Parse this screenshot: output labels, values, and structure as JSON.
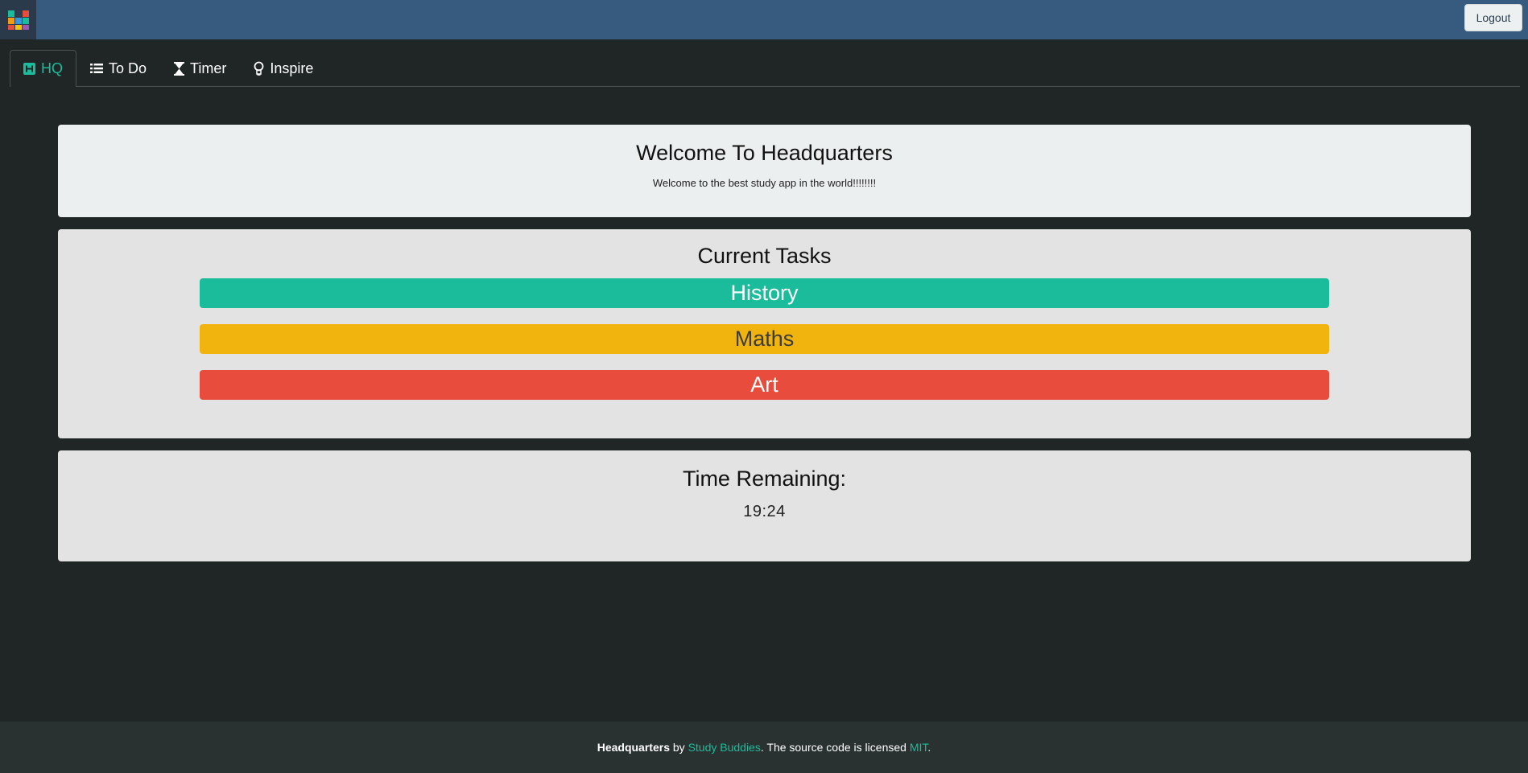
{
  "header": {
    "logo_icon": "app-logo-icon",
    "logout_label": "Logout"
  },
  "tabs": [
    {
      "label": "HQ",
      "icon": "hq-icon",
      "active": true
    },
    {
      "label": "To Do",
      "icon": "list-icon",
      "active": false
    },
    {
      "label": "Timer",
      "icon": "hourglass-icon",
      "active": false
    },
    {
      "label": "Inspire",
      "icon": "lightbulb-icon",
      "active": false
    }
  ],
  "welcome": {
    "title": "Welcome To Headquarters",
    "subtitle": "Welcome to the best study app in the world!!!!!!!!"
  },
  "tasks": {
    "title": "Current Tasks",
    "items": [
      {
        "label": "History",
        "color": "#1abc9c",
        "text_color": "#ffffff"
      },
      {
        "label": "Maths",
        "color": "#f1b40f",
        "text_color": "#3b3b3b"
      },
      {
        "label": "Art",
        "color": "#e74c3c",
        "text_color": "#ffffff"
      }
    ]
  },
  "timer": {
    "title": "Time Remaining:",
    "time": "19:24"
  },
  "footer": {
    "app_name": "Headquarters",
    "by": " by ",
    "author": "Study Buddies",
    "middle": ". The source code is licensed ",
    "license": "MIT",
    "end": "."
  },
  "colors": {
    "accent": "#1abc9c",
    "navbar": "#375a7f",
    "background": "#202626"
  }
}
